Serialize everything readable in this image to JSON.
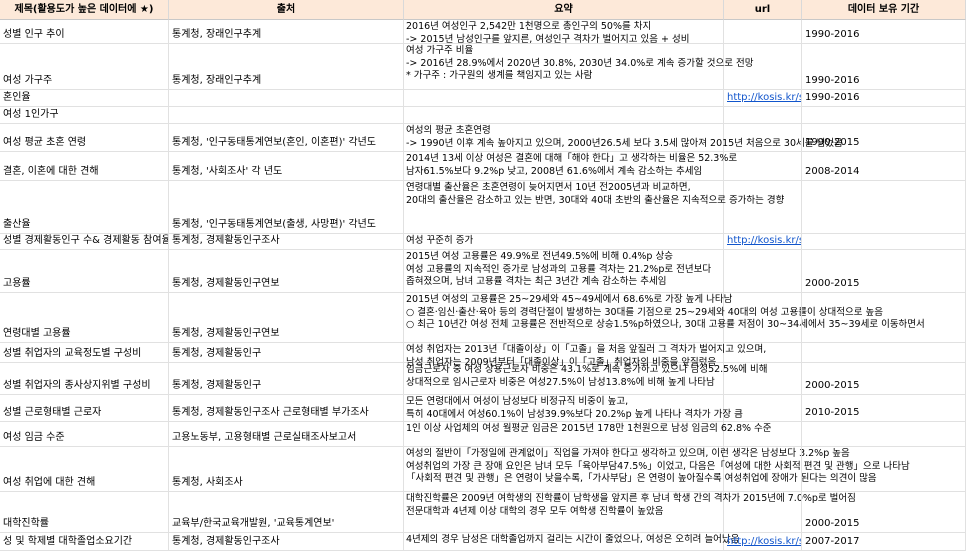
{
  "headers": [
    "제목(활용도가 높은 데이터에 ★)",
    "출처",
    "요약",
    "url",
    "데이터 보유 기간"
  ],
  "rows": [
    {
      "title": "성별 인구 추이",
      "source": "통계청, 장래인구추계",
      "summary": [
        "2016년 여성인구 2,542만 1천명으로 총인구의 50%를 차지",
        "-> 2015년 남성인구를 앞지른, 여성인구 격차가 벌어지고 있음 + 성비"
      ],
      "url": "",
      "period": "1990-2016"
    },
    {
      "title": "여성 가구주",
      "source": "통계청, 장래인구추계",
      "summary": [
        "여성 가구주 비율",
        "-> 2016년 28.9%에서 2020년 30.8%, 2030년 34.0%로 계속 증가할 것으로 전망",
        "* 가구주 : 가구원의  생계를 책임지고 있는 사람"
      ],
      "url": "",
      "period": "1990-2016"
    },
    {
      "title": "혼인율",
      "source": "",
      "summary": [],
      "url": "http://kosis.kr/sta",
      "period": "1990-2016"
    },
    {
      "title": "여성 1인가구",
      "source": "",
      "summary": [],
      "url": "",
      "period": ""
    },
    {
      "title": "여성 평균 초혼 연령",
      "source": "통계청, '인구동태통계연보(혼인, 이혼편)' 각년도",
      "summary": [
        "여성의 평균 초혼연령",
        "-> 1990년 이후 계속 높아지고 있으며, 2000년26.5세 보다 3.5세 많아져 2015년 처음으로 30세를 넘었음"
      ],
      "url": "",
      "period": "1990-2015"
    },
    {
      "title": "결혼, 이혼에 대한 견해",
      "source": "통계청, '사회조사' 각 년도",
      "summary": [
        "2014년 13세 이상 여성은 결혼에 대해「해야 한다」고 생각하는 비율은 52.3%로",
        "남자61.5%보다 9.2%p 낮고, 2008년 61.6%에서 계속 감소하는 추세임"
      ],
      "url": "",
      "period": "2008-2014"
    },
    {
      "title": "출산율",
      "source": "통계청, '인구동태통계연보(출생, 사망편)' 각년도",
      "summary": [
        "연령대별 출산율은 초혼연령이 늦어지면서 10년 전2005년과 비교하면,",
        "20대의 출산율은 감소하고 있는 반면, 30대와 40대 초반의 출산율은 지속적으로 증가하는 경향"
      ],
      "url": "",
      "period": ""
    },
    {
      "title": "성별 경제활동인구 수& 경제활동 참여율",
      "source": "통계청, 경제활동인구조사",
      "summary": [
        "여성 꾸준히 증가"
      ],
      "url": "http://kosis.kr/sta",
      "period": ""
    },
    {
      "title": "고용률",
      "source": "통계청, 경제활동인구연보",
      "summary": [
        "2015년 여성 고용률은 49.9%로 전년49.5%에 비해 0.4%p 상승",
        "여성 고용률의 지속적인 증가로 남성과의 고용률 격차는 21.2%p로 전년보다",
        "좁혀졌으며, 남녀 고용률 격차는 최근 3년간 계속 감소하는 추세임"
      ],
      "url": "",
      "period": "2000-2015"
    },
    {
      "title": "연령대별 고용률",
      "source": "통계청, 경제활동인구연보",
      "summary": [
        "2015년 여성의 고용률은 25~29세와 45~49세에서 68.6%로 가장 높게 나타남",
        "○ 결혼·임신·출산·육아 등의 경력단절이 발생하는 30대를 기점으로 25~29세와 40대의 여성 고용률이 상대적으로 높음",
        "○ 최근 10년간 여성 전체 고용률은 전반적으로 상승1.5%p하였으나, 30대 고용률 저점이 30~34세에서 35~39세로 이동하면서"
      ],
      "url": "",
      "period": ""
    },
    {
      "title": "성별 취업자의 교육정도별 구성비",
      "source": "통계청, 경제활동인구",
      "summary": [
        "여성 취업자는 2013년「대졸이상」이「고졸」을 처음 앞질러 그 격차가 벌어지고 있으며,",
        "남성 취업자는 2009년부터「대졸이상」이「고졸」취업자의 비중을 앞질렀음"
      ],
      "url": "",
      "period": ""
    },
    {
      "title": "성별 취업자의 종사상지위별 구성비",
      "source": "통계청, 경제활동인구",
      "summary": [
        "임금근로자 중 여성 상용근로자 비중은 43.1%로 계속 증가하고 있으나 남성52.5%에 비해",
        "상대적으로 임시근로자 비중은 여성27.5%이 남성13.8%에 비해 높게 나타남"
      ],
      "url": "",
      "period": "2000-2015"
    },
    {
      "title": "성별 근로형태별 근로자",
      "source": "통계청, 경제활동인구조사 근로형태별 부가조사",
      "summary": [
        "모든 연령대에서 여성이 남성보다 비정규직 비중이 높고,",
        "특히 40대에서 여성60.1%이 남성39.9%보다 20.2%p 높게 나타나 격차가 가장 큼"
      ],
      "url": "",
      "period": "2010-2015"
    },
    {
      "title": "여성 임금 수준",
      "source": "고용노동부, 고용형태별 근로실태조사보고서",
      "summary": [
        "1인 이상 사업체의 여성 월평균 임금은 2015년 178만 1천원으로 남성 임금의 62.8% 수준"
      ],
      "url": "",
      "period": ""
    },
    {
      "title": "여성 취업에 대한 견해",
      "source": "통계청, 사회조사",
      "summary": [
        "여성의 절반이「가정일에 관계없이」직업을 가져야 한다고 생각하고 있으며, 이런 생각은 남성보다 3.2%p 높음",
        "여성취업의 가장 큰 장애 요인은 남녀 모두「육아부담47.5%」이었고, 다음은「여성에 대한 사회적 편견 및 관행」으로 나타남",
        "「사회적 편견 및 관행」은 연령이 낮을수록,「가사부담」은 연령이 높아질수록 여성취업에 장애가 된다는 의견이 많음"
      ],
      "url": "",
      "period": ""
    },
    {
      "title": "대학진학률",
      "source": "교육부/한국교육개발원, '교육통계연보'",
      "summary": [
        "대학진학률은 2009년 여학생의 진학률이 남학생을 앞지른 후 남녀 학생 간의 격차가 2015년에 7.0%p로 벌어짐",
        "전문대학과 4년제 이상 대학의 경우 모두 여학생 진학률이 높았음"
      ],
      "url": "",
      "period": "2000-2015"
    },
    {
      "title": "성 및 학제별 대학졸업소요기간",
      "source": "통계청, 경제활동인구조사",
      "summary": [
        "4년제의 경우 남성은 대학졸업까지 걸리는 시간이 줄었으나, 여성은 오히려 늘어났음"
      ],
      "url": "http://kosis.kr/sta",
      "period": "2007-2017"
    }
  ]
}
